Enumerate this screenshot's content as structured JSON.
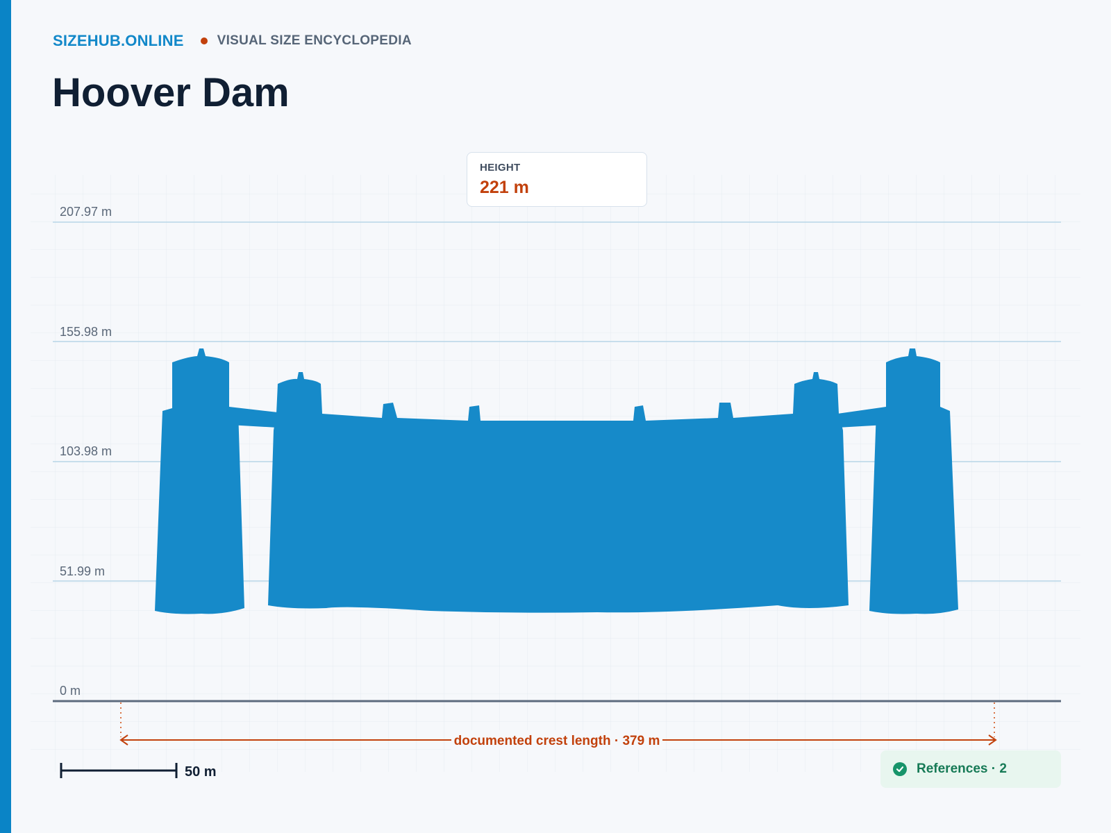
{
  "header": {
    "brand": "SIZEHUB.ONLINE",
    "tagline": "VISUAL SIZE ENCYCLOPEDIA",
    "title": "Hoover Dam"
  },
  "height_card": {
    "label": "HEIGHT",
    "value": "221 m"
  },
  "diagram": {
    "gridlines": [
      {
        "label": "207.97 m",
        "value": 207.97
      },
      {
        "label": "155.98 m",
        "value": 155.98
      },
      {
        "label": "103.98 m",
        "value": 103.98
      },
      {
        "label": "51.99 m",
        "value": 51.99
      },
      {
        "label": "0 m",
        "value": 0
      }
    ],
    "crest_length_label": "documented crest length · 379 m",
    "crest_length_m": 379,
    "scale_bar": {
      "label": "50 m",
      "meters": 50
    }
  },
  "references": {
    "label": "References · 2"
  },
  "colors": {
    "accent": "#0a84c6",
    "dam": "#168ac9",
    "measure": "#c2410c",
    "success": "#17946a"
  },
  "icons": {
    "references": "check-circle-icon"
  }
}
